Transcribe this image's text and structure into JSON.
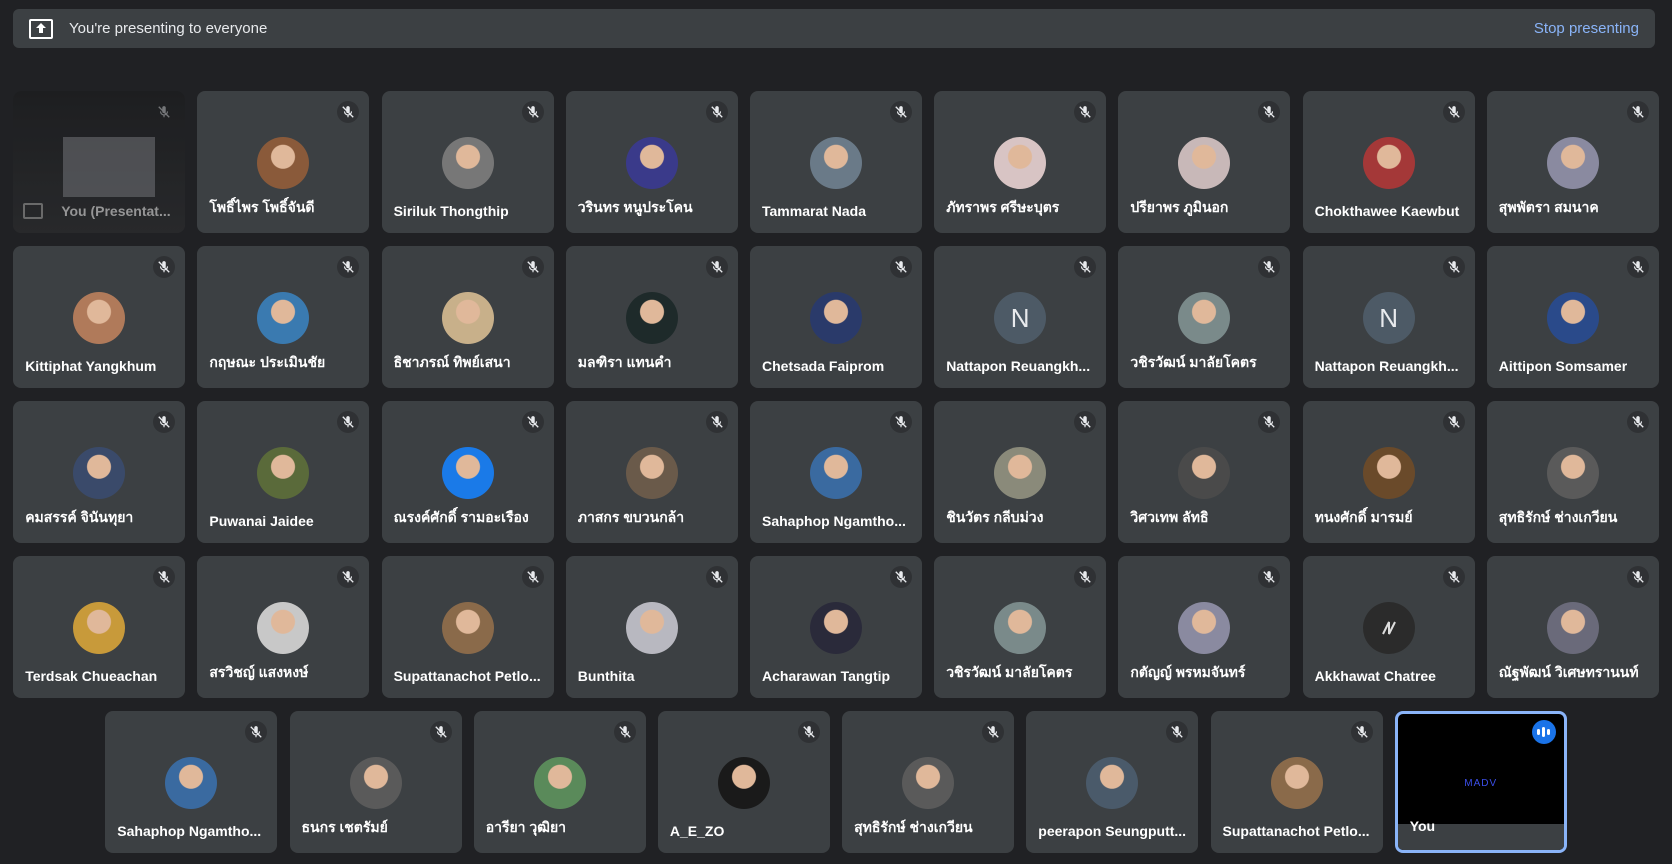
{
  "banner": {
    "text": "You're presenting to everyone",
    "stop_label": "Stop presenting"
  },
  "colors": {
    "background": "#202124",
    "tile": "#3c4043",
    "accent": "#8ab4f8",
    "speaking": "#1a73e8"
  },
  "rows": [
    [
      {
        "name": "You (Presentat...",
        "type": "presenting",
        "muted": true
      },
      {
        "name": "โพธิ์ไพร โพธิ์จันดี",
        "avatar": "photo",
        "color": "#8a5a3a",
        "muted": true
      },
      {
        "name": "Siriluk Thongthip",
        "avatar": "photo",
        "color": "#777777",
        "muted": true
      },
      {
        "name": "วรินทร หนูประโคน",
        "avatar": "photo",
        "color": "#3a3a8a",
        "muted": true
      },
      {
        "name": "Tammarat Nada",
        "avatar": "photo",
        "color": "#6a7a88",
        "muted": true
      },
      {
        "name": "ภัทราพร ศรีษะบุตร",
        "avatar": "photo",
        "color": "#d8c4c4",
        "muted": true
      },
      {
        "name": "ปรียาพร ภูมินอก",
        "avatar": "photo",
        "color": "#c8b8b8",
        "muted": true
      },
      {
        "name": "Chokthawee Kaewbut",
        "avatar": "photo",
        "color": "#a43838",
        "muted": true
      },
      {
        "name": "สุพพัตรา สมนาค",
        "avatar": "photo",
        "color": "#8a8aa0",
        "muted": true
      }
    ],
    [
      {
        "name": "Kittiphat Yangkhum",
        "avatar": "photo",
        "color": "#b07a5a",
        "muted": true
      },
      {
        "name": "กฤษณะ ประเมินชัย",
        "avatar": "photo",
        "color": "#3a7ab0",
        "muted": true
      },
      {
        "name": "ธิชาภรณ์ ทิพย์เสนา",
        "avatar": "photo",
        "color": "#c8b08a",
        "muted": true
      },
      {
        "name": "มลฑิรา แทนคำ",
        "avatar": "photo",
        "color": "#1e2a2a",
        "muted": true
      },
      {
        "name": "Chetsada Faiprom",
        "avatar": "photo",
        "color": "#2a3a6a",
        "muted": true
      },
      {
        "name": "Nattapon Reuangkh...",
        "avatar": "letter",
        "letter": "N",
        "muted": true
      },
      {
        "name": "วชิรวัฒน์ มาลัยโคตร",
        "avatar": "photo",
        "color": "#7a8a8a",
        "muted": true
      },
      {
        "name": "Nattapon Reuangkh...",
        "avatar": "letter",
        "letter": "N",
        "muted": true
      },
      {
        "name": "Aittipon Somsamer",
        "avatar": "photo",
        "color": "#2a4a8a",
        "muted": true
      }
    ],
    [
      {
        "name": "คมสรรค์ จินันทุยา",
        "avatar": "photo",
        "color": "#3a4a6a",
        "muted": true
      },
      {
        "name": "Puwanai Jaidee",
        "avatar": "photo",
        "color": "#5a6a3a",
        "muted": true
      },
      {
        "name": "ณรงค์ศักดิ์ รามอะเรือง",
        "avatar": "photo",
        "color": "#1a7ae8",
        "muted": true
      },
      {
        "name": "ภาสกร ขบวนกล้า",
        "avatar": "photo",
        "color": "#6a5a4a",
        "muted": true
      },
      {
        "name": "Sahaphop Ngamtho...",
        "avatar": "photo",
        "color": "#3a6aa0",
        "muted": true
      },
      {
        "name": "ชินวัตร กลีบม่วง",
        "avatar": "photo",
        "color": "#8a8a7a",
        "muted": true
      },
      {
        "name": "วิศวเทพ ลัทธิ",
        "avatar": "photo",
        "color": "#4a4a4a",
        "muted": true
      },
      {
        "name": "ทนงศักดิ์ มารมย์",
        "avatar": "photo",
        "color": "#6a4a2a",
        "muted": true
      },
      {
        "name": "สุทธิรักษ์ ช่างเกวียน",
        "avatar": "photo",
        "color": "#5a5a5a",
        "muted": true
      }
    ],
    [
      {
        "name": "Terdsak Chueachan",
        "avatar": "photo",
        "color": "#c89a3a",
        "muted": true
      },
      {
        "name": "สรวิชญ์ แสงหงษ์",
        "avatar": "photo",
        "color": "#c8c8c8",
        "muted": true
      },
      {
        "name": "Supattanachot Petlo...",
        "avatar": "photo",
        "color": "#8a6a4a",
        "muted": true
      },
      {
        "name": "Bunthita",
        "avatar": "photo",
        "color": "#b8b8c0",
        "muted": true
      },
      {
        "name": "Acharawan Tangtip",
        "avatar": "photo",
        "color": "#2a2a3a",
        "muted": true
      },
      {
        "name": "วชิรวัฒน์ มาลัยโคตร",
        "avatar": "photo",
        "color": "#7a8a8a",
        "muted": true
      },
      {
        "name": "กตัญญ์ พรหมจันทร์",
        "avatar": "photo",
        "color": "#8a8aa0",
        "muted": true
      },
      {
        "name": "Akkhawat Chatree",
        "avatar": "logo",
        "color": "#2b2b2b",
        "muted": true
      },
      {
        "name": "ณัฐพัฒน์ วิเศษทรานนท์",
        "avatar": "photo",
        "color": "#6a6a7a",
        "muted": true
      }
    ],
    [
      {
        "name": "Sahaphop Ngamtho...",
        "avatar": "photo",
        "color": "#3a6aa0",
        "muted": true
      },
      {
        "name": "ธนกร เชตรัมย์",
        "avatar": "photo",
        "color": "#5a5a5a",
        "muted": true
      },
      {
        "name": "อารียา วุฒิยา",
        "avatar": "photo",
        "color": "#5a8a5a",
        "muted": true
      },
      {
        "name": "A_E_ZO",
        "avatar": "photo",
        "color": "#1a1a1a",
        "muted": true
      },
      {
        "name": "สุทธิรักษ์ ช่างเกวียน",
        "avatar": "photo",
        "color": "#5a5a5a",
        "muted": true
      },
      {
        "name": "peerapon Seungputt...",
        "avatar": "photo",
        "color": "#4a5a6a",
        "muted": true
      },
      {
        "name": "Supattanachot Petlo...",
        "avatar": "photo",
        "color": "#8a6a4a",
        "muted": true
      },
      {
        "name": "You",
        "type": "you",
        "video_text": "MADV"
      }
    ]
  ]
}
